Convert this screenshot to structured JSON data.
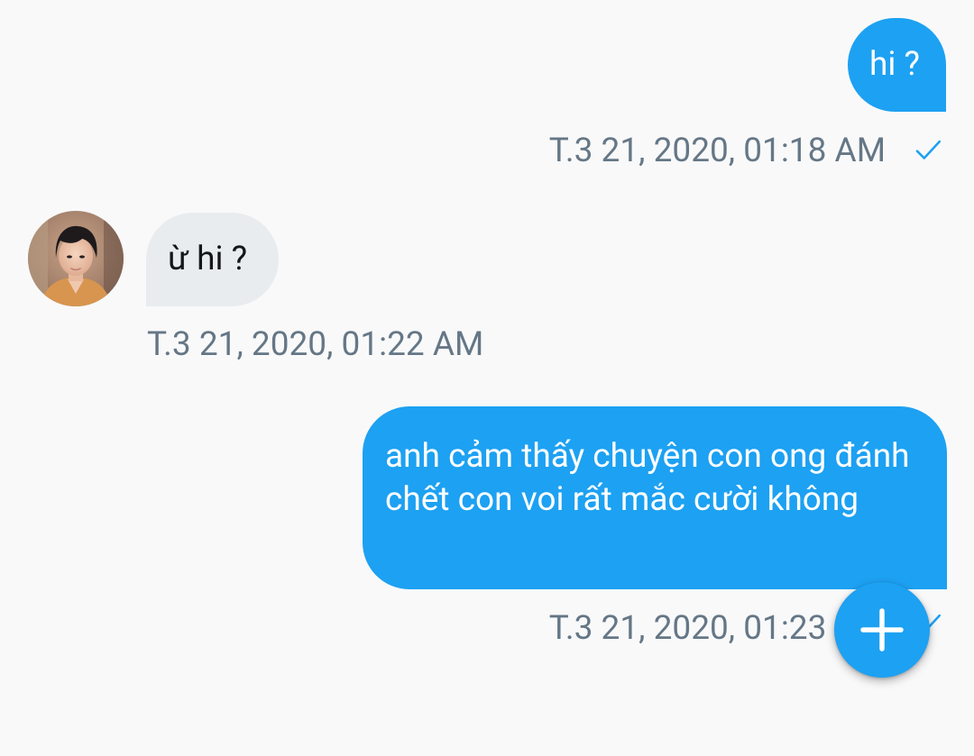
{
  "messages": [
    {
      "direction": "outgoing",
      "text": "hi ?",
      "timestamp": "T.3 21, 2020, 01:18 AM",
      "status_icon": "check-icon"
    },
    {
      "direction": "incoming",
      "text": "ừ hi ?",
      "timestamp": "T.3 21, 2020, 01:22 AM",
      "avatar_icon": "user-avatar"
    },
    {
      "direction": "outgoing",
      "text": "anh cảm thấy chuyện con ong đánh chết con voi rất mắc cười không",
      "timestamp": "T.3 21, 2020, 01:23 AM",
      "status_icon": "check-icon"
    }
  ],
  "fab": {
    "icon": "plus-icon"
  },
  "colors": {
    "accent": "#1da1f2",
    "incoming_bubble": "#e9ecef",
    "timestamp": "#657786",
    "background": "#f9f9fa"
  }
}
